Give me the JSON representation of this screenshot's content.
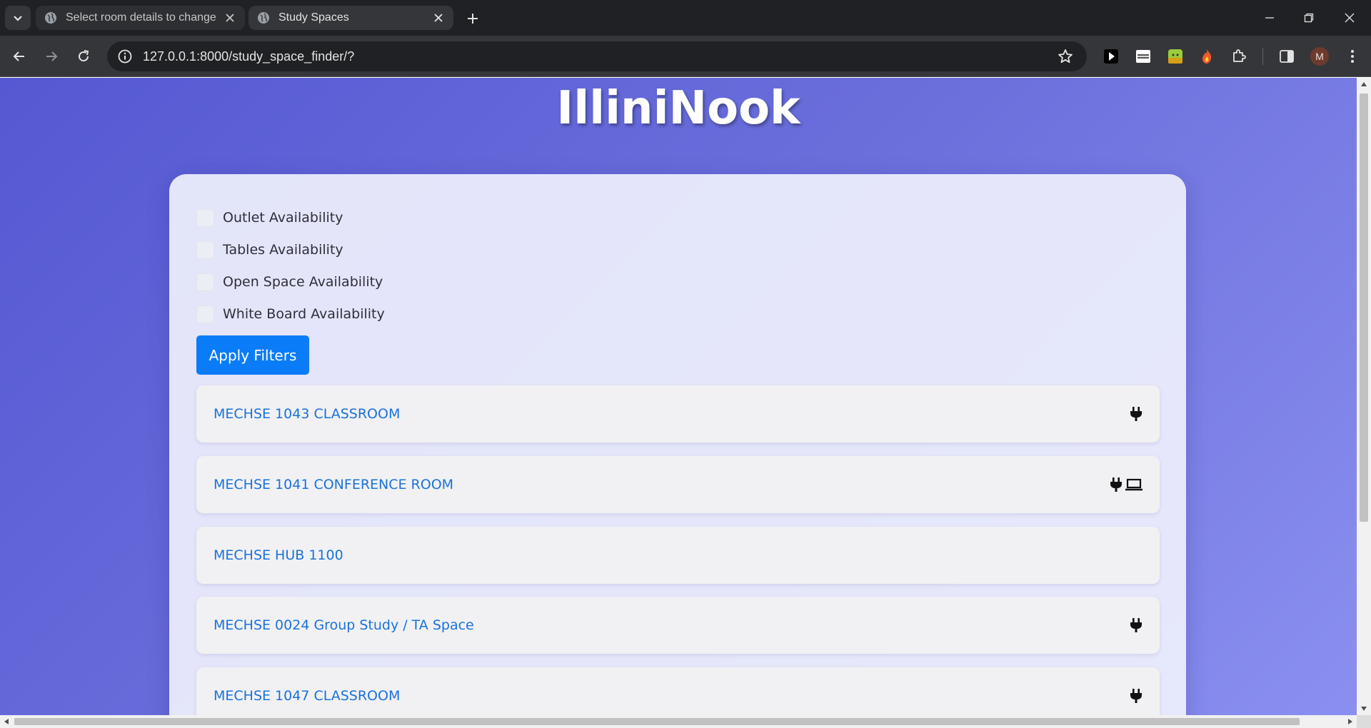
{
  "browser": {
    "tabs": [
      {
        "title": "Select room details to change |",
        "active": false
      },
      {
        "title": "Study Spaces",
        "active": true
      }
    ],
    "url": "127.0.0.1:8000/study_space_finder/?",
    "profile_initial": "M",
    "extensions": [
      "play-extension-icon",
      "idm-extension-icon",
      "green-extension-icon",
      "fire-extension-icon",
      "puzzle-extension-icon",
      "side-panel-icon"
    ]
  },
  "page": {
    "title": "IlliniNook",
    "filters": [
      {
        "label": "Outlet Availability",
        "checked": false
      },
      {
        "label": "Tables Availability",
        "checked": false
      },
      {
        "label": "Open Space Availability",
        "checked": false
      },
      {
        "label": "White Board Availability",
        "checked": false
      }
    ],
    "apply_label": "Apply Filters",
    "rooms": [
      {
        "name": "MECHSE 1043 CLASSROOM",
        "icons": [
          "plug-icon"
        ]
      },
      {
        "name": "MECHSE 1041 CONFERENCE ROOM",
        "icons": [
          "plug-icon",
          "monitor-icon"
        ]
      },
      {
        "name": "MECHSE HUB 1100",
        "icons": []
      },
      {
        "name": "MECHSE 0024 Group Study / TA Space",
        "icons": [
          "plug-icon"
        ]
      },
      {
        "name": "MECHSE 1047 CLASSROOM",
        "icons": [
          "plug-icon"
        ]
      }
    ]
  },
  "colors": {
    "accent": "#0b7cf7",
    "link": "#1a72d9",
    "background_start": "#5558d2",
    "background_end": "#8a8ff0"
  }
}
